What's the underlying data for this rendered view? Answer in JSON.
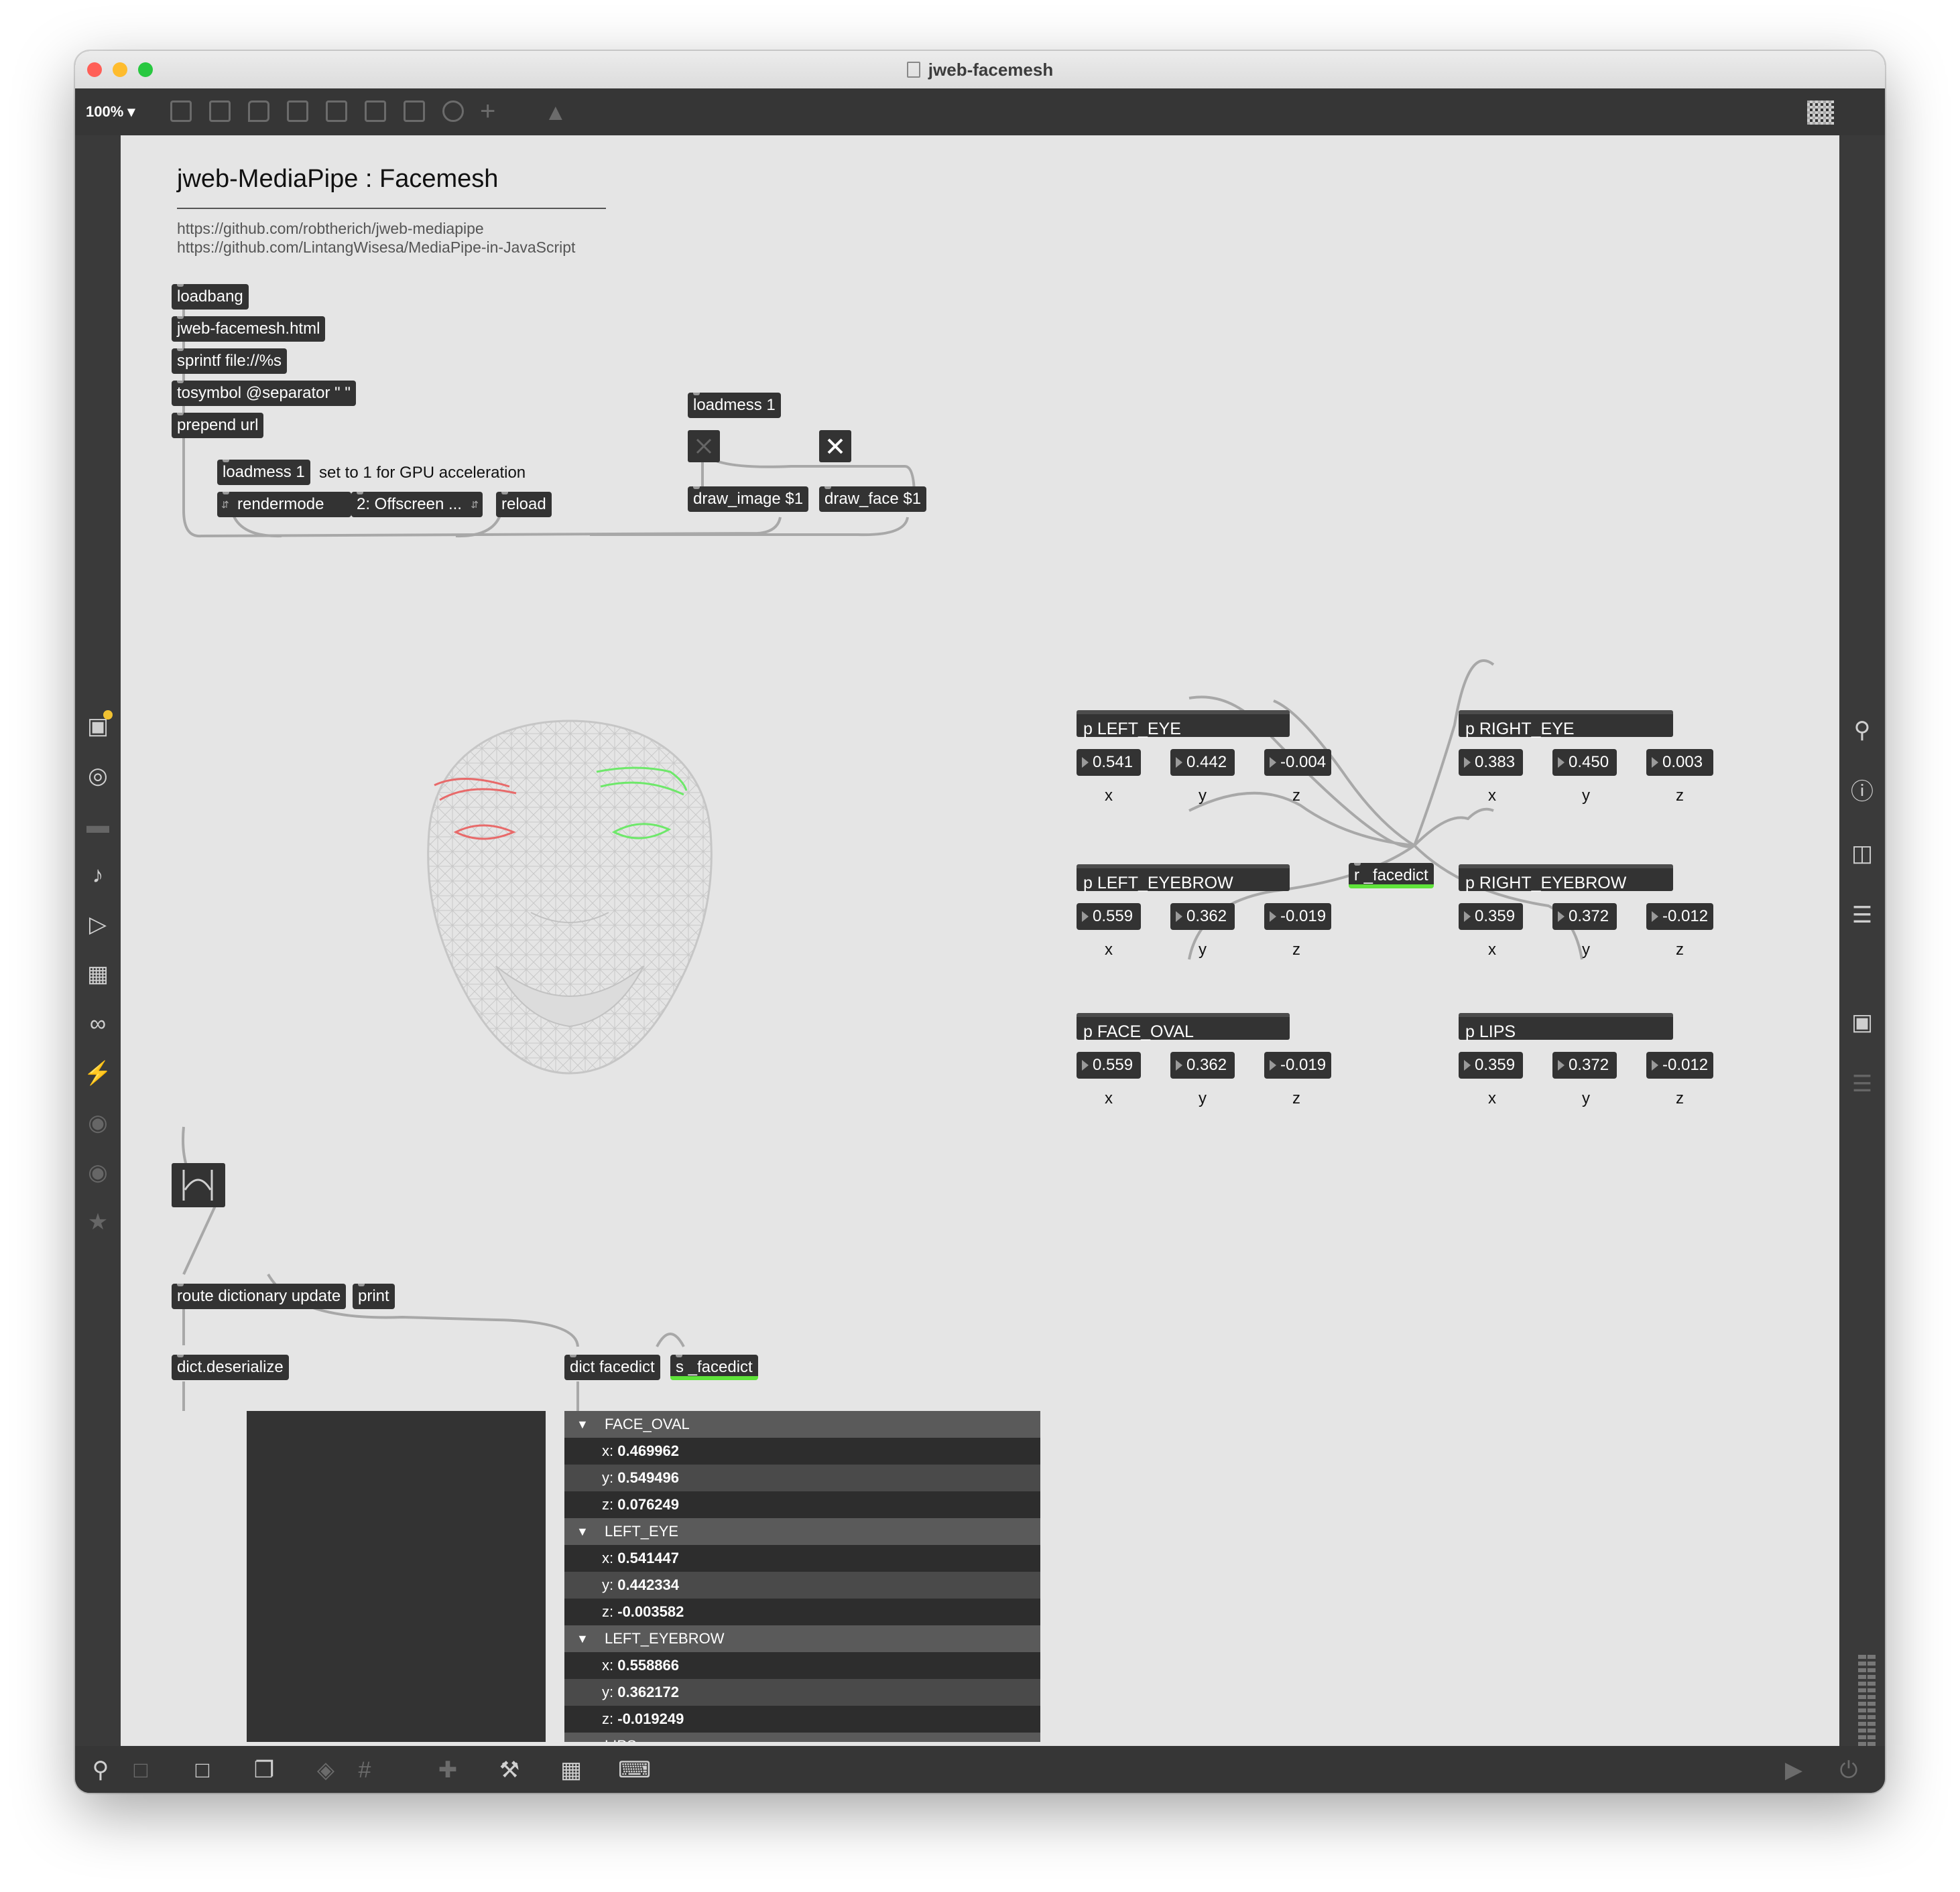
{
  "window": {
    "title": "jweb-facemesh",
    "zoom": "100%"
  },
  "patch": {
    "heading": "jweb-MediaPipe : Facemesh",
    "links": [
      "https://github.com/robtherich/jweb-mediapipe",
      "https://github.com/LintangWisesa/MediaPipe-in-JavaScript"
    ],
    "objects": {
      "loadbang": "loadbang",
      "html_msg": "jweb-facemesh.html",
      "sprintf": "sprintf file://%s",
      "tosymbol": "tosymbol @separator \" \"",
      "prepend": "prepend url",
      "loadmess_gpu": "loadmess 1",
      "gpu_comment": "set to 1 for GPU acceleration",
      "rendermode": "rendermode",
      "rendermode_value": "2: Offscreen ...",
      "reload": "reload",
      "loadmess_draw": "loadmess 1",
      "draw_image": "draw_image $1",
      "draw_face": "draw_face $1",
      "route": "route dictionary update",
      "print": "print",
      "deserialize": "dict.deserialize",
      "dict_facedict": "dict facedict",
      "send_facedict": "s _facedict",
      "receive_facedict": "r _facedict"
    },
    "landmarks": [
      {
        "name": "p LEFT_EYE",
        "x": "0.541",
        "y": "0.442",
        "z": "-0.004"
      },
      {
        "name": "p RIGHT_EYE",
        "x": "0.383",
        "y": "0.450",
        "z": "0.003"
      },
      {
        "name": "p LEFT_EYEBROW",
        "x": "0.559",
        "y": "0.362",
        "z": "-0.019"
      },
      {
        "name": "p RIGHT_EYEBROW",
        "x": "0.359",
        "y": "0.372",
        "z": "-0.012"
      },
      {
        "name": "p FACE_OVAL",
        "x": "0.559",
        "y": "0.362",
        "z": "-0.019"
      },
      {
        "name": "p LIPS",
        "x": "0.359",
        "y": "0.372",
        "z": "-0.012"
      }
    ],
    "axis_labels": [
      "x",
      "y",
      "z"
    ],
    "dict_view": [
      {
        "key": "FACE_OVAL",
        "values": [
          {
            "k": "x:",
            "v": "0.469962"
          },
          {
            "k": "y:",
            "v": "0.549496"
          },
          {
            "k": "z:",
            "v": "0.076249"
          }
        ]
      },
      {
        "key": "LEFT_EYE",
        "values": [
          {
            "k": "x:",
            "v": "0.541447"
          },
          {
            "k": "y:",
            "v": "0.442334"
          },
          {
            "k": "z:",
            "v": "-0.003582"
          }
        ]
      },
      {
        "key": "LEFT_EYEBROW",
        "values": [
          {
            "k": "x:",
            "v": "0.558866"
          },
          {
            "k": "y:",
            "v": "0.362172"
          },
          {
            "k": "z:",
            "v": "-0.019249"
          }
        ]
      },
      {
        "key": "LIPS",
        "values": []
      }
    ]
  },
  "colors": {
    "send_receive_accent": "#5fe33a",
    "left_features": "#6ee86a",
    "right_features": "#e86a6a",
    "object_bg": "#333333",
    "canvas_bg": "#e5e5e5"
  },
  "icons": {
    "left_sidebar": [
      "packages-icon",
      "target-icon",
      "presentation-icon",
      "music-note-icon",
      "media-icon",
      "image-icon",
      "paperclip-icon",
      "plug-icon",
      "vimeo-icon",
      "bpatcher-icon",
      "star-icon"
    ],
    "right_sidebar": [
      "search-icon",
      "info-icon",
      "columns-icon",
      "list-icon",
      "camera-icon",
      "mixer-icon"
    ],
    "bottom_bar": [
      "lock-icon",
      "select-icon",
      "presentation-icon",
      "windows-icon",
      "mute-icon",
      "grid-icon",
      "add-object-icon",
      "wrench-icon",
      "piano-icon",
      "keyboard-icon",
      "play-icon",
      "power-icon"
    ]
  }
}
